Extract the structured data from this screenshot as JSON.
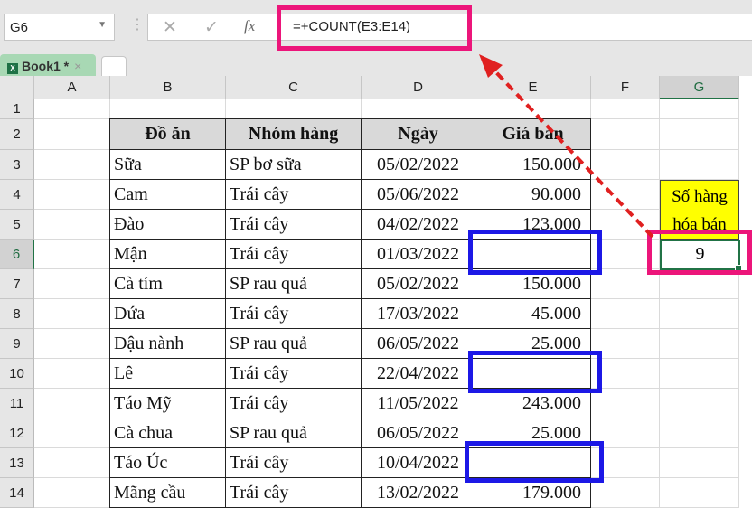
{
  "name_box": "G6",
  "formula_icons": {
    "cancel": "✕",
    "enter": "✓",
    "fx": "fx"
  },
  "formula": "=+COUNT(E3:E14)",
  "tab": {
    "label": "Book1 *",
    "close": "×",
    "icon": "X"
  },
  "columns": [
    "A",
    "B",
    "C",
    "D",
    "E",
    "F",
    "G"
  ],
  "rows": [
    "1",
    "2",
    "3",
    "4",
    "5",
    "6",
    "7",
    "8",
    "9",
    "10",
    "11",
    "12",
    "13",
    "14"
  ],
  "table": {
    "headers": [
      "Đồ ăn",
      "Nhóm hàng",
      "Ngày",
      "Giá bán"
    ],
    "rows": [
      [
        "Sữa",
        "SP bơ sữa",
        "05/02/2022",
        "150.000"
      ],
      [
        "Cam",
        "Trái cây",
        "05/06/2022",
        "90.000"
      ],
      [
        "Đào",
        "Trái cây",
        "04/02/2022",
        "123.000"
      ],
      [
        "Mận",
        "Trái cây",
        "01/03/2022",
        ""
      ],
      [
        "Cà tím",
        "SP rau quả",
        "05/02/2022",
        "150.000"
      ],
      [
        "Dứa",
        "Trái cây",
        "17/03/2022",
        "45.000"
      ],
      [
        "Đậu nành",
        "SP rau quả",
        "06/05/2022",
        "25.000"
      ],
      [
        "Lê",
        "Trái cây",
        "22/04/2022",
        ""
      ],
      [
        "Táo Mỹ",
        "Trái cây",
        "11/05/2022",
        "243.000"
      ],
      [
        "Cà chua",
        "SP rau quả",
        "06/05/2022",
        "25.000"
      ],
      [
        "Táo Úc",
        "Trái cây",
        "10/04/2022",
        ""
      ],
      [
        "Mãng cầu",
        "Trái cây",
        "13/02/2022",
        "179.000"
      ]
    ]
  },
  "result": {
    "label_line1": "Số hàng",
    "label_line2": "hóa bán",
    "value": "9"
  },
  "colors": {
    "highlight_pink": "#ec157a",
    "highlight_blue": "#1c18e6",
    "arrow": "#e02020",
    "label_bg": "#ffff00"
  }
}
